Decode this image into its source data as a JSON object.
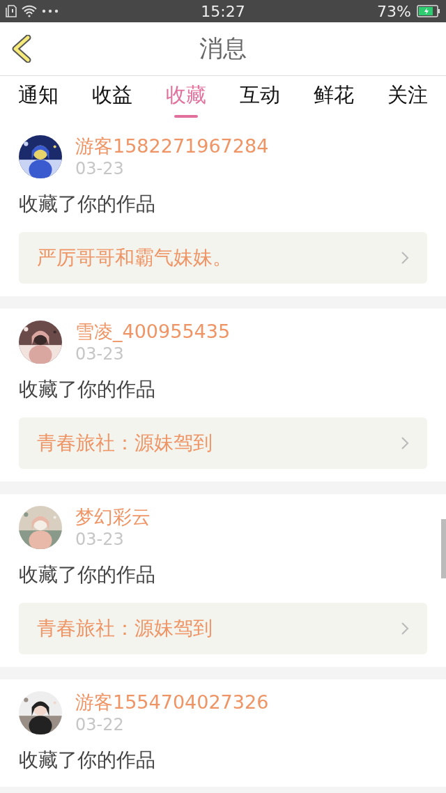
{
  "status_bar": {
    "time": "15:27",
    "battery": "73%"
  },
  "header": {
    "title": "消息"
  },
  "tabs": [
    {
      "label": "通知",
      "selected": false
    },
    {
      "label": "收益",
      "selected": false
    },
    {
      "label": "收藏",
      "selected": true
    },
    {
      "label": "互动",
      "selected": false
    },
    {
      "label": "鲜花",
      "selected": false
    },
    {
      "label": "关注",
      "selected": false
    }
  ],
  "messages": [
    {
      "user": "游客1582271967284",
      "date": "03-23",
      "text": "收藏了你的作品",
      "work": "严厉哥哥和霸气妹妹。"
    },
    {
      "user": "雪凌_400955435",
      "date": "03-23",
      "text": "收藏了你的作品",
      "work": "青春旅社：源妹驾到"
    },
    {
      "user": "梦幻彩云",
      "date": "03-23",
      "text": "收藏了你的作品",
      "work": "青春旅社：源妹驾到"
    },
    {
      "user": "游客1554704027326",
      "date": "03-22",
      "text": "收藏了你的作品"
    }
  ]
}
